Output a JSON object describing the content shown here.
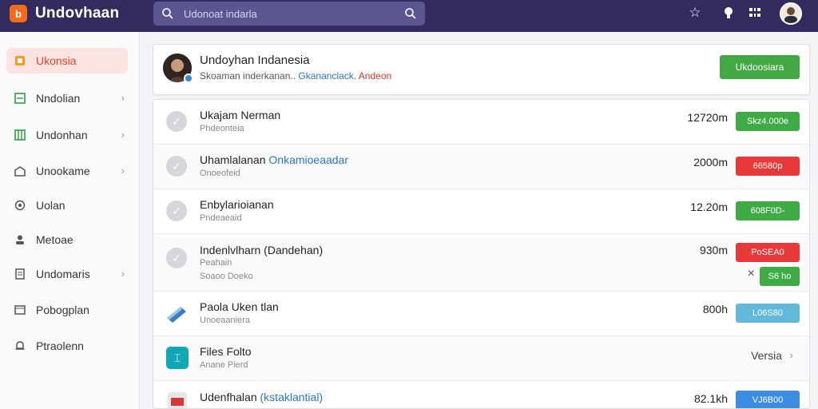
{
  "app": {
    "title": "Undovhaan",
    "logo_glyph": "b"
  },
  "search": {
    "placeholder": "Udonoat indarla"
  },
  "colors": {
    "topbar": "#332a5e",
    "accent": "#e2432f",
    "green": "#3fab47",
    "red": "#e8393a",
    "teal": "#62b8d8",
    "blue": "#3a8de0"
  },
  "sidebar": {
    "items": [
      {
        "label": "Ukonsia",
        "icon": "dashboard-icon",
        "active": true
      },
      {
        "label": "Nndolian",
        "icon": "chart-icon"
      },
      {
        "label": "Undonhan",
        "icon": "table-icon"
      },
      {
        "label": "Unookame",
        "icon": "building-icon"
      },
      {
        "label": "Uolan",
        "icon": "circle-icon"
      },
      {
        "label": "Metoae",
        "icon": "user-icon"
      },
      {
        "label": "Undomaris",
        "icon": "document-icon"
      },
      {
        "label": "Pobogplan",
        "icon": "window-icon"
      },
      {
        "label": "Ptraolenn",
        "icon": "bell-icon"
      }
    ]
  },
  "profile": {
    "name": "Undoyhan Indanesia",
    "sub_plain": "Skoaman inderkanan..",
    "sub_blue": "Gkananclack.",
    "sub_red": "Andeon",
    "button": "Ukdoosiara"
  },
  "rows": [
    {
      "title": "Ukajam Nerman",
      "sub": "Phdeonteia",
      "value": "12720m",
      "button": "Skz4.000e"
    },
    {
      "title": "Uhamlalanan",
      "title_blue": "Onkamioeaadar",
      "sub": "Onoeofeid",
      "value": "2000m",
      "button": "66580p"
    },
    {
      "title": "Enbylarioianan",
      "sub": "Pndeaeaid",
      "value": "12.20m",
      "button": "608F0D-"
    },
    {
      "title": "Indenlvlharn (Dandehan)",
      "sub": "Peahain",
      "sub2": "Soaoo Doeko",
      "value": "930m",
      "button": "PoSEA0",
      "button2": "S6 ho",
      "close": "×"
    },
    {
      "title": "Paola Uken tlan",
      "sub": "Unoeaaniera",
      "value": "800h",
      "button": "L06S80"
    },
    {
      "title": "Files Folto",
      "sub": "Anane Pierd",
      "link": "Versia"
    },
    {
      "title": "Udenfhalan",
      "title_blue": "(kstaklantial)",
      "value": "82.1kh",
      "button": "VJ6B00"
    }
  ]
}
